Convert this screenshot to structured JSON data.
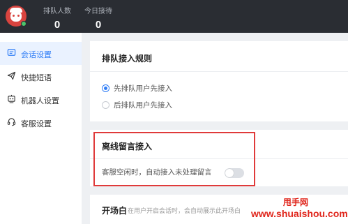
{
  "topbar": {
    "stats": [
      {
        "label": "排队人数",
        "value": "0"
      },
      {
        "label": "今日接待",
        "value": "0"
      }
    ],
    "status_color": "#4cc46b"
  },
  "sidebar": {
    "items": [
      {
        "label": "会话设置",
        "icon": "chat-window-icon",
        "active": true
      },
      {
        "label": "快捷短语",
        "icon": "send-plane-icon",
        "active": false
      },
      {
        "label": "机器人设置",
        "icon": "robot-icon",
        "active": false
      },
      {
        "label": "客服设置",
        "icon": "headset-icon",
        "active": false
      }
    ]
  },
  "queue_rules": {
    "title": "排队接入规则",
    "options": [
      {
        "label": "先排队用户先接入",
        "checked": true
      },
      {
        "label": "后排队用户先接入",
        "checked": false
      }
    ]
  },
  "offline_access": {
    "title": "离线留言接入",
    "setting_label": "客服空闲时，自动接入未处理留言",
    "enabled": false
  },
  "opening": {
    "title": "开场白",
    "description": "在用户开启会话时，会自动展示此开场白"
  },
  "watermark": {
    "line1": "甩手网",
    "line2": "www.shuaishou.com"
  },
  "colors": {
    "accent": "#2f7df6",
    "highlight_border": "#e03a3a",
    "topbar": "#2a2d33"
  }
}
